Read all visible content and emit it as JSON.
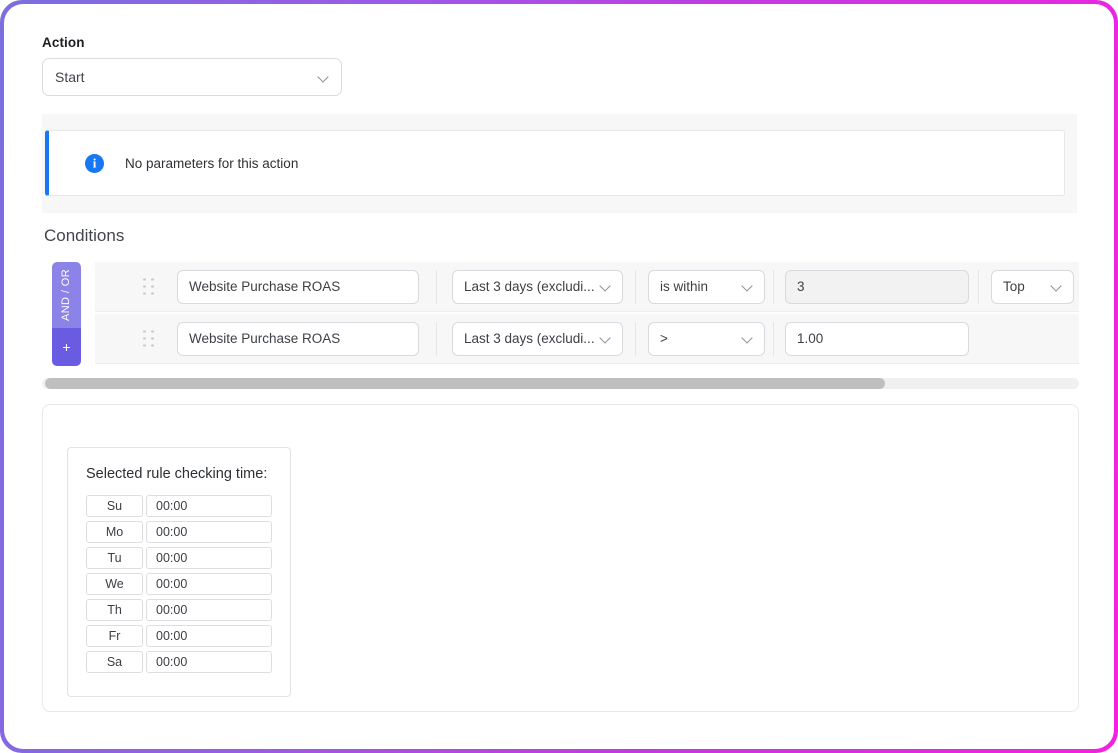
{
  "action": {
    "label": "Action",
    "selected": "Start",
    "chevron_icon": "chevron-down-icon"
  },
  "info_banner": {
    "icon": "info-circle-icon",
    "text": "No parameters for this action",
    "accent_color": "#1877f2"
  },
  "conditions": {
    "title": "Conditions",
    "andor_label": "AND / OR",
    "add_label": "+",
    "andor_color": "#8c83e8",
    "add_color": "#6a5ce0",
    "drag_handle_icon": "drag-handle-icon",
    "rows": [
      {
        "metric": "Website Purchase ROAS",
        "window": "Last 3 days (excludi...",
        "operator": "is within",
        "value": "3",
        "value_disabled": true,
        "rank": "Top",
        "has_rank": true
      },
      {
        "metric": "Website Purchase ROAS",
        "window": "Last 3 days (excludi...",
        "operator": ">",
        "value": "1.00",
        "value_disabled": false,
        "rank": "",
        "has_rank": false
      }
    ]
  },
  "scrollbar": {
    "name": "horizontal-scrollbar",
    "thumb_color": "#bfbfc2"
  },
  "schedule": {
    "title": "Selected rule checking time:",
    "days": [
      {
        "day": "Su",
        "time": "00:00"
      },
      {
        "day": "Mo",
        "time": "00:00"
      },
      {
        "day": "Tu",
        "time": "00:00"
      },
      {
        "day": "We",
        "time": "00:00"
      },
      {
        "day": "Th",
        "time": "00:00"
      },
      {
        "day": "Fr",
        "time": "00:00"
      },
      {
        "day": "Sa",
        "time": "00:00"
      }
    ]
  },
  "frame": {
    "gradient_start": "#7b6fe0",
    "gradient_end": "#f520e0"
  }
}
